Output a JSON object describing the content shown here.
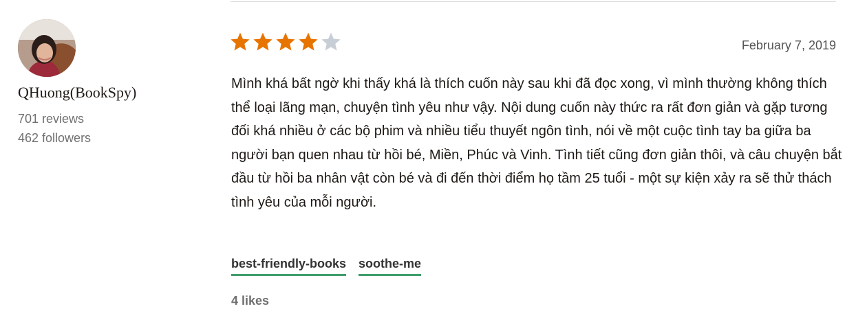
{
  "reviewer": {
    "name": "QHuong(BookSpy)",
    "reviews": "701 reviews",
    "followers": "462 followers"
  },
  "review": {
    "rating": 4,
    "max_rating": 5,
    "date": "February 7, 2019",
    "text": "Mình khá bất ngờ khi thấy khá là thích cuốn này sau khi đã đọc xong, vì mình thường không thích thể loại lãng mạn, chuyện tình yêu như vậy. Nội dung cuốn này thức ra rất đơn giản và gặp tương đối khá nhiều ở các bộ phim và nhiều tiểu thuyết ngôn tình, nói về một cuộc tình tay ba giữa ba người bạn quen nhau từ hồi bé, Miền, Phúc và Vinh. Tình tiết cũng đơn giản thôi, và câu chuyện bắt đầu từ hồi ba nhân vật còn bé và đi đến thời điểm họ tầm 25 tuổi - một sự kiện xảy ra sẽ thử thách tình yêu của mỗi người.",
    "tags": [
      "best-friendly-books",
      "soothe-me"
    ],
    "likes": "4 likes"
  },
  "colors": {
    "star_filled": "#e87400",
    "star_empty": "#c7ced6",
    "tag_underline": "#409d69"
  }
}
